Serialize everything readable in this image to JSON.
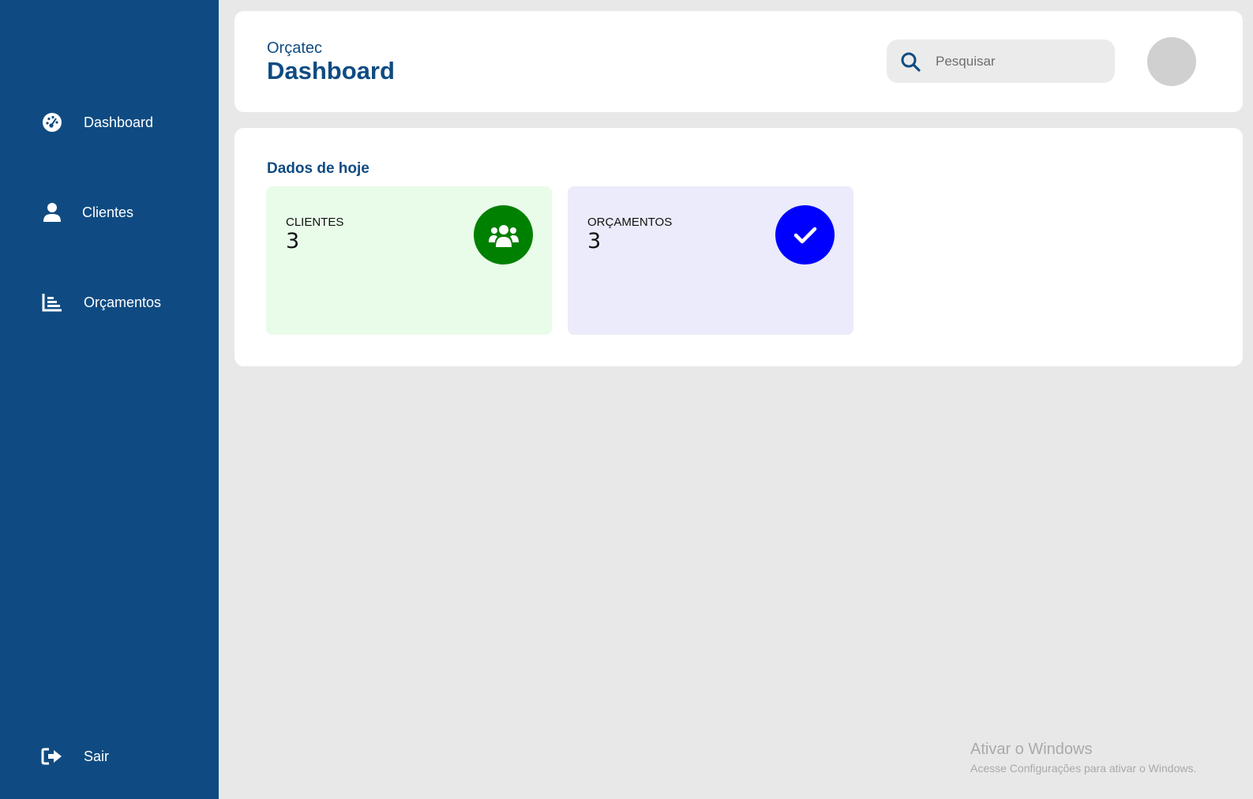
{
  "app": {
    "brand": "Orçatec",
    "page_title": "Dashboard"
  },
  "sidebar": {
    "items": [
      {
        "label": "Dashboard",
        "icon": "gauge-icon"
      },
      {
        "label": "Clientes",
        "icon": "user-icon"
      },
      {
        "label": "Orçamentos",
        "icon": "bar-chart-icon"
      }
    ],
    "logout": {
      "label": "Sair",
      "icon": "logout-icon"
    }
  },
  "search": {
    "placeholder": "Pesquisar",
    "value": ""
  },
  "main": {
    "section_title": "Dados de hoje",
    "stats": [
      {
        "label": "CLIENTES",
        "value": "3",
        "icon": "users-icon",
        "color": "#008000",
        "bg": "#e9fbe9"
      },
      {
        "label": "ORÇAMENTOS",
        "value": "3",
        "icon": "check-icon",
        "color": "#0000ff",
        "bg": "#ebebfb"
      }
    ]
  },
  "watermark": {
    "title": "Ativar o Windows",
    "subtitle": "Acesse Configurações para ativar o Windows."
  },
  "colors": {
    "sidebar": "#0f4b82",
    "accent": "#0f4b82",
    "background": "#e9e8e9"
  }
}
